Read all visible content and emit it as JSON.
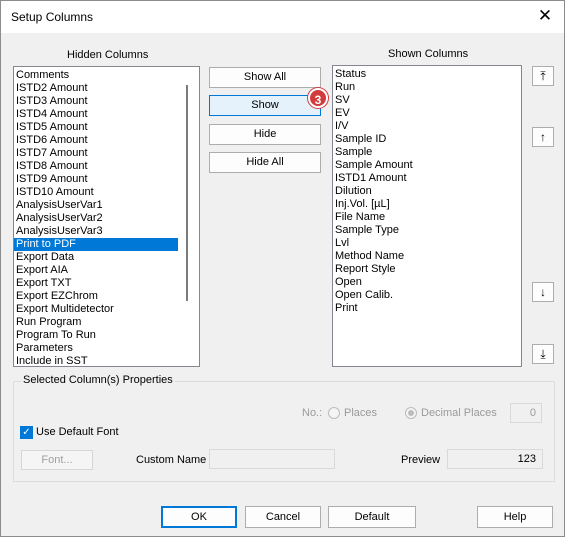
{
  "window": {
    "title": "Setup Columns",
    "close_icon": "close-icon"
  },
  "hidden": {
    "label": "Hidden Columns",
    "items": [
      "Comments",
      "ISTD2 Amount",
      "ISTD3 Amount",
      "ISTD4 Amount",
      "ISTD5 Amount",
      "ISTD6 Amount",
      "ISTD7 Amount",
      "ISTD8 Amount",
      "ISTD9 Amount",
      "ISTD10 Amount",
      "AnalysisUserVar1",
      "AnalysisUserVar2",
      "AnalysisUserVar3",
      "Print to PDF",
      "Export Data",
      "Export AIA",
      "Export TXT",
      "Export EZChrom",
      "Export Multidetector",
      "Run Program",
      "Program To Run",
      "Parameters",
      "Include in SST"
    ],
    "selected_index": 13
  },
  "shown": {
    "label": "Shown Columns",
    "items": [
      "Status",
      "Run",
      "SV",
      "EV",
      "I/V",
      "Sample ID",
      "Sample",
      "Sample Amount",
      "ISTD1 Amount",
      "Dilution",
      "Inj.Vol. [µL]",
      "File Name",
      "Sample Type",
      "Lvl",
      "Method Name",
      "Report Style",
      "Open",
      "Open Calib.",
      "Print"
    ]
  },
  "middle_buttons": {
    "show_all": "Show All",
    "show": "Show",
    "hide": "Hide",
    "hide_all": "Hide All"
  },
  "badge": "3",
  "arrows": {
    "top": "⤒",
    "up": "↑",
    "down": "↓",
    "bottom": "⤓"
  },
  "properties": {
    "title": "Selected Column(s) Properties",
    "no_label": "No.:",
    "places_label": "Places",
    "decimal_places_label": "Decimal Places",
    "decimal_value": "0",
    "use_default_font": "Use Default Font",
    "font_button": "Font...",
    "custom_name_label": "Custom Name",
    "custom_name_value": "",
    "preview_label": "Preview",
    "preview_value": "123"
  },
  "footer": {
    "ok": "OK",
    "cancel": "Cancel",
    "default": "Default",
    "help": "Help"
  },
  "colors": {
    "accent": "#0078d7",
    "badge": "#d13b3b"
  }
}
